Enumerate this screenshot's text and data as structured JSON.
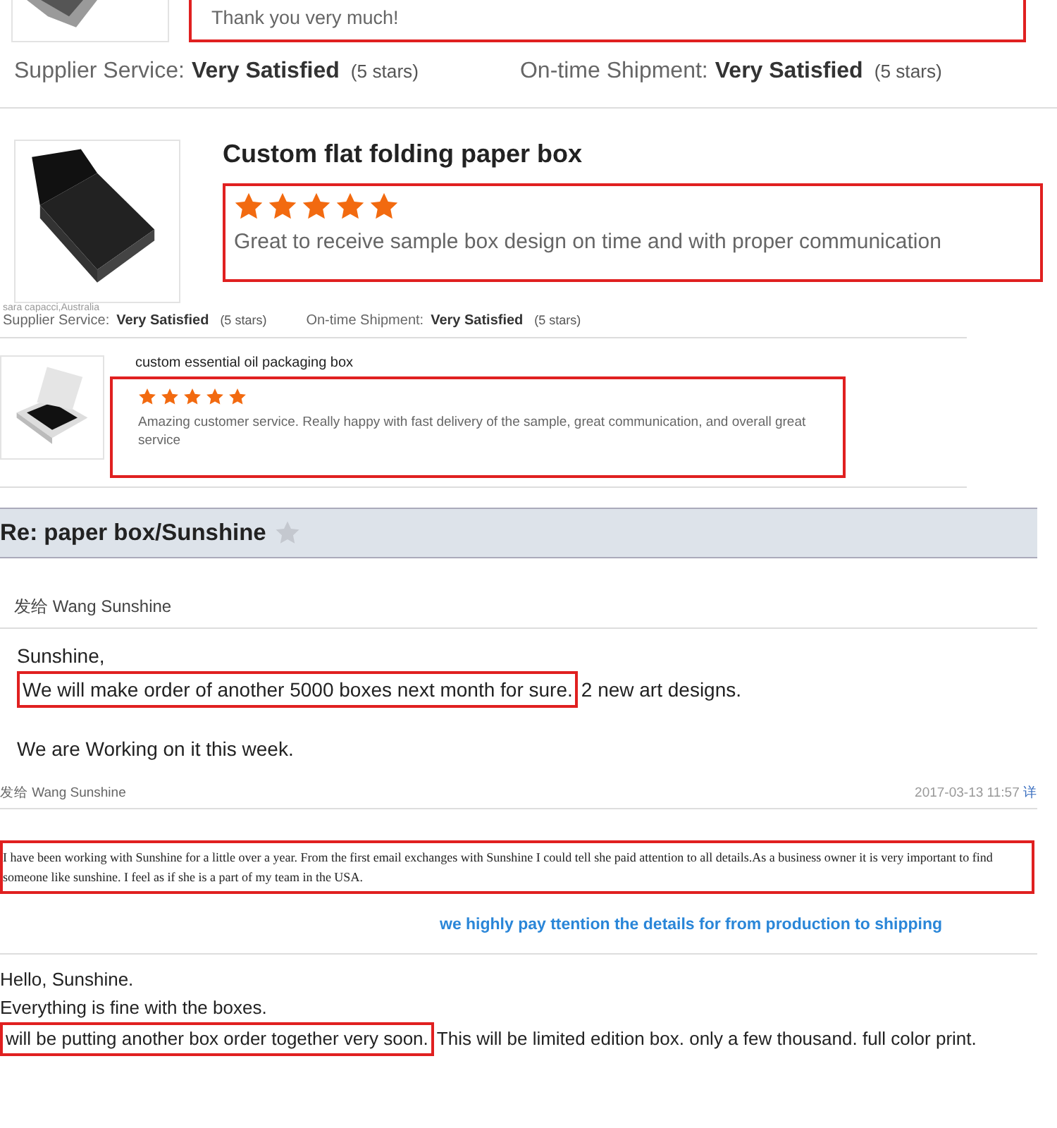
{
  "top_review": {
    "comment": "Thank you very much!",
    "ratings": [
      {
        "label": "Supplier Service:",
        "value": "Very Satisfied",
        "count": "(5 stars)"
      },
      {
        "label": "On-time Shipment:",
        "value": "Very Satisfied",
        "count": "(5 stars)"
      }
    ]
  },
  "reviews": [
    {
      "kind": "large",
      "title": "Custom flat folding paper box",
      "stars": 5,
      "comment": "Great to receive sample box design on time and with proper communication",
      "reviewer": "sara capacci,Australia",
      "ratings": [
        {
          "label": "Supplier Service:",
          "value": "Very Satisfied",
          "count": "(5 stars)"
        },
        {
          "label": "On-time Shipment:",
          "value": "Very Satisfied",
          "count": "(5 stars)"
        }
      ]
    },
    {
      "kind": "small",
      "title": "custom essential oil packaging box",
      "stars": 5,
      "comment": "Amazing customer service. Really happy with fast delivery of the sample, great communication, and overall great service"
    }
  ],
  "message": {
    "subject": "Re: paper box/Sunshine",
    "starred": false,
    "to": "发给 Wang Sunshine",
    "greeting": "Sunshine,",
    "highlight": "We will make order of another 5000 boxes next month for sure.",
    "rest": "2 new art  designs.",
    "closing": "We are Working on it this week.",
    "footer_to": "发给 Wang Sunshine",
    "date": "2017-03-13 11:57",
    "link": "详"
  },
  "testimonial": "I have been working with Sunshine for a little over a year. From the first email exchanges with Sunshine I could tell she paid attention to all details.As a business owner it is very important to find someone like sunshine. I feel as if she is a part of my team in the USA.",
  "caption": "we highly pay ttention the details for  from production to shipping",
  "last_message": {
    "lines": [
      "Hello, Sunshine.",
      "Everything is fine with the boxes."
    ],
    "highlight": "will be putting another box order together very soon.",
    "rest": "This will be limited edition box. only a few thousand. full color print."
  }
}
